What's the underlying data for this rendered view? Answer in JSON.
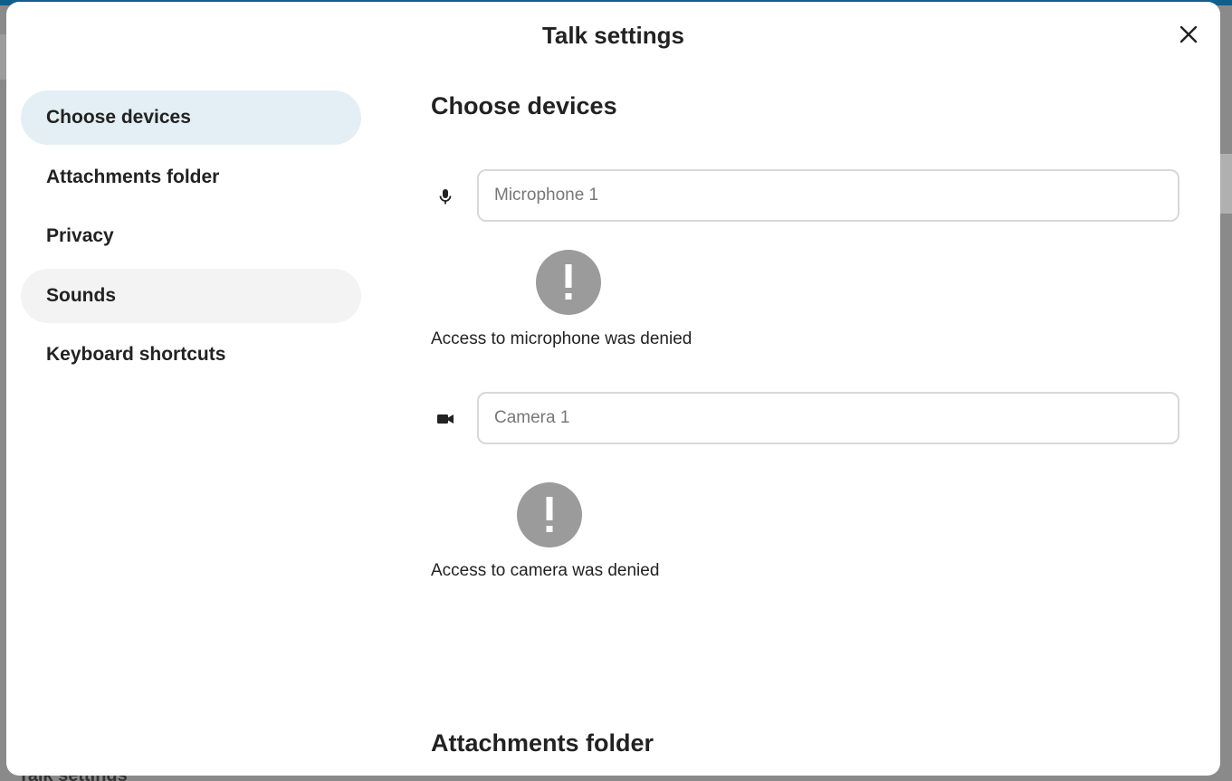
{
  "dialog": {
    "title": "Talk settings"
  },
  "nav": {
    "items": [
      {
        "label": "Choose devices"
      },
      {
        "label": "Attachments folder"
      },
      {
        "label": "Privacy"
      },
      {
        "label": "Sounds"
      },
      {
        "label": "Keyboard shortcuts"
      }
    ],
    "active": "Choose devices"
  },
  "devices": {
    "heading": "Choose devices",
    "microphone": {
      "value": "Microphone 1",
      "denied_text": "Access to microphone was denied"
    },
    "camera": {
      "value": "Camera 1",
      "denied_text": "Access to camera was denied"
    }
  },
  "attachments": {
    "heading": "Attachments folder"
  },
  "background": {
    "partial_text": "Talk settings"
  },
  "colors": {
    "active_nav": "#e3eff4",
    "hover_nav": "#f3f3f3",
    "badge": "#9b9b9b",
    "topbar": "#0f5f8c"
  },
  "icons": {
    "close": "close-icon",
    "microphone": "microphone-icon",
    "camera": "video-camera-icon",
    "denied": "exclamation-icon"
  }
}
